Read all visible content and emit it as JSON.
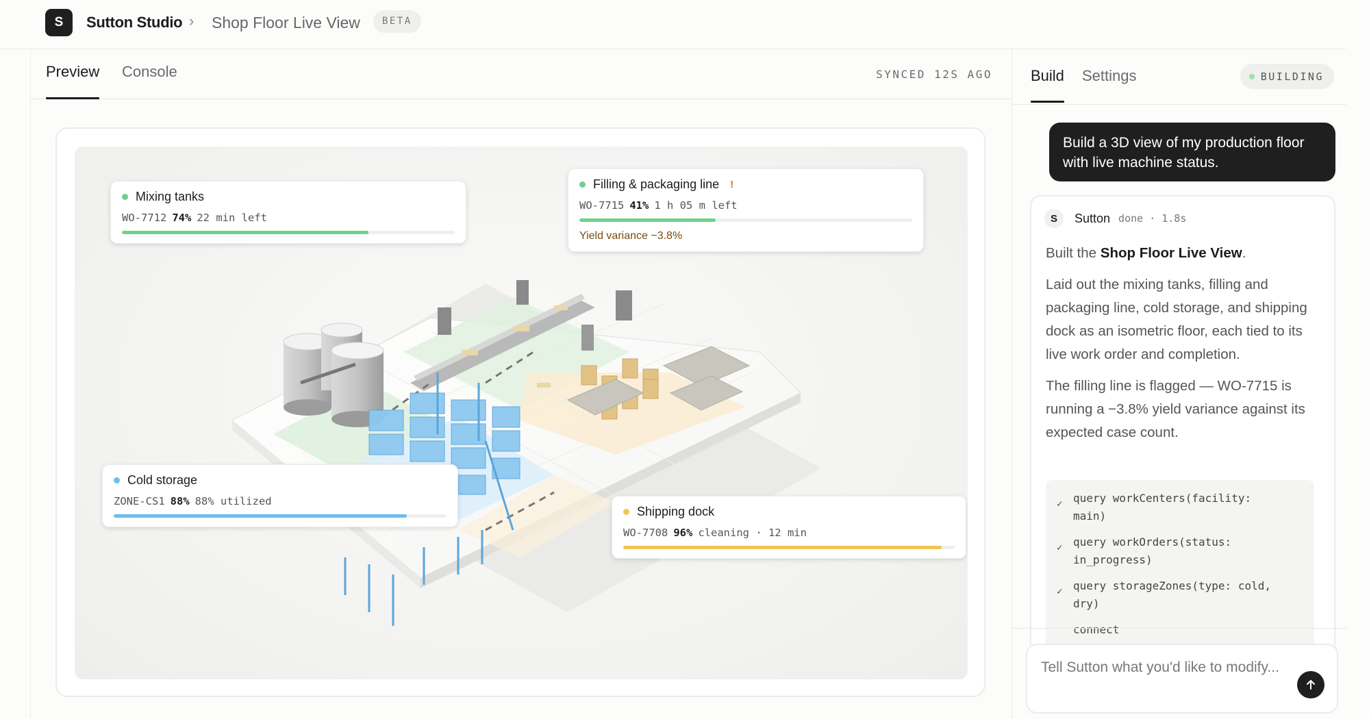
{
  "header": {
    "logo_letter": "S",
    "org_name": "Sutton Studio",
    "separator": "›",
    "page_title": "Shop Floor Live View",
    "badge": "BETA"
  },
  "left_tabs": {
    "preview": "Preview",
    "console": "Console",
    "synced": "SYNCED 12S AGO"
  },
  "cards": {
    "mixing": {
      "name": "Mixing tanks",
      "wo": "WO-7712",
      "pct": "74%",
      "detail": "22 min left",
      "progress": 0.74,
      "color": "#6fd08c"
    },
    "filling": {
      "name": "Filling & packaging line",
      "flag": "!",
      "wo": "WO-7715",
      "pct": "41%",
      "detail": "1 h 05 m left",
      "progress": 0.41,
      "color": "#6fd08c",
      "variance": "Yield variance −3.8%"
    },
    "cold": {
      "name": "Cold storage",
      "wo": "ZONE-CS1",
      "pct": "88%",
      "detail": "88% utilized",
      "progress": 0.88,
      "color": "#69bfee"
    },
    "shipping": {
      "name": "Shipping dock",
      "wo": "WO-7708",
      "pct": "96%",
      "detail": "cleaning · 12 min",
      "progress": 0.96,
      "color": "#f2c456"
    }
  },
  "right_tabs": {
    "build": "Build",
    "settings": "Settings",
    "status": "BUILDING",
    "status_color": "#9fe0b0"
  },
  "user_message": "Build a 3D view of my production floor with live machine status.",
  "assistant": {
    "avatar": "S",
    "name": "Sutton",
    "status": "done · 1.8s",
    "intro_prefix": "Built the ",
    "intro_bold": "Shop Floor Live View",
    "intro_suffix": ".",
    "para1": "Laid out the mixing tanks, filling and packaging line, cold storage, and shipping dock as an isometric floor, each tied to its live work order and completion.",
    "para2": "The filling line is flagged — WO-7715 is running a −3.8% yield variance against its expected case count.",
    "tools": [
      {
        "check": "✓",
        "text": "query workCenters(facility:\nmain)"
      },
      {
        "check": "✓",
        "text": "query workOrders(status:\nin_progress)"
      },
      {
        "check": "✓",
        "text": "query storageZones(type: cold,\ndry)"
      },
      {
        "check": "",
        "text": "connect"
      }
    ]
  },
  "chat_input": {
    "placeholder": "Tell Sutton what you'd like to modify..."
  },
  "icons": {
    "send": "arrow-up-icon"
  }
}
